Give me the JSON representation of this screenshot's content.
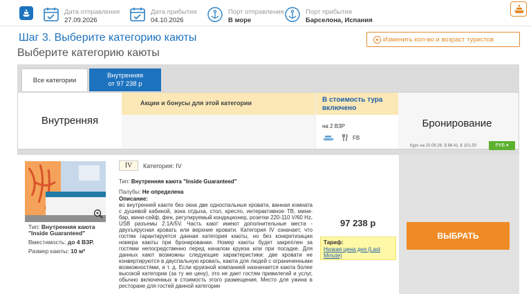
{
  "top": {
    "departure_date_label": "Дата отправления",
    "departure_date": "27.09.2026",
    "arrival_date_label": "Дата прибытия",
    "arrival_date": "04.10.2026",
    "departure_port_label": "Порт отправления",
    "departure_port": "В море",
    "arrival_port_label": "Порт прибытия",
    "arrival_port": "Барселона, Испания"
  },
  "heading": {
    "step": "Шаг 3.  Выберите категорию каюты",
    "subtitle": "Выберите категорию каюты",
    "change_button": "Изменить кол-во и возраст туристов"
  },
  "tabs": {
    "all": "Все категории",
    "inner_line1": "Внутренняя",
    "inner_line2": "от 97 238 р"
  },
  "header": {
    "category_name": "Внутренняя",
    "promo_title": "Акции и бонусы для этой категории",
    "included_title": "В стоимость тура включено",
    "included_meals": "на 2 ВЗР",
    "included_fb": "FB",
    "booking_title": "Бронирование",
    "rate_text": "Курс на 20.09.26: $ 88.41, € 101.50",
    "currency": "РУБ"
  },
  "cabin": {
    "type_label": "Тип:",
    "type_value": "Внутренняя каюта \"Inside Guaranteed\"",
    "capacity_label": "Вместимость:",
    "capacity_value": "до 4 ВЗР.",
    "size_label": "Размер каюты:",
    "size_value": "10 м²",
    "category_code": "IV",
    "category_label": "Категория: IV",
    "desc_type_label": "Тип:",
    "desc_type_value": "Внутренняя каюта \"Inside Guaranteed\"",
    "deck_label": "Палубы:",
    "deck_value": "Не определена",
    "description_label": "Описание:",
    "description": "во внутренней каюте без окна две односпальные кровати, ванная комната с душевой кабиной, зона отдыха, стол, кресло, интерактивное ТВ, мини-бар, мини-сейф, фен, регулируемый кондиционер, розетки 220-110 V/60 Hz, USB разъемы 2.1А/5V. Часть кают имеют дополнительные места - двухъярусная кровать или верхние кровати. Категория IV означает, что гостям гарантируется данная категория каюты, но без конкретизации номера каюты при бронировании. Номер каюты будет закреплен за гостями непосредственно перед началом круиза или при посадке. Для данных кают возможны следующие характеристики: две кровати не конвертируются в двуспальную кровать, каюта для людей с ограниченными возможностями, и т. д. Если круизной компанией назначается каюта более высокой категории (за ту же цену), это не дает гостям привилегий и услуг, обычно включенных в стоимость этого размещения. Место для ужина в ресторане для гостей данной категории",
    "price": "97 238 р",
    "tariff_label": "Тариф:",
    "tariff_value": "Низкая цена дня (Last Minute)",
    "select_button": "ВЫБРАТЬ"
  },
  "colors": {
    "accent": "#1e73be",
    "orange": "#f08a24",
    "highlight": "#fbe8b6"
  }
}
